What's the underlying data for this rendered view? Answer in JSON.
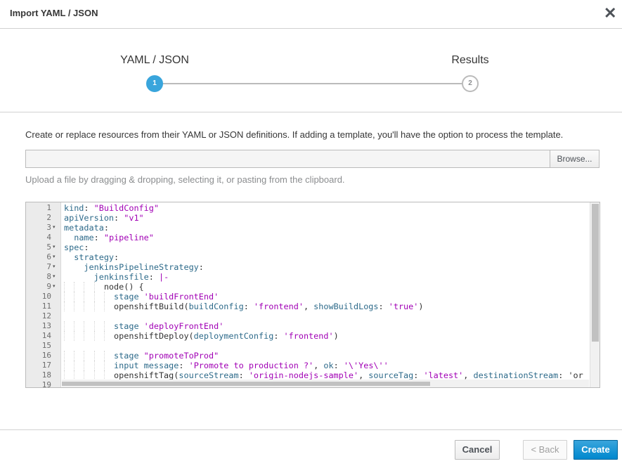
{
  "dialog": {
    "title": "Import YAML / JSON",
    "close_glyph": "✕"
  },
  "wizard": {
    "steps": [
      {
        "label": "YAML / JSON",
        "number": "1",
        "state": "active"
      },
      {
        "label": "Results",
        "number": "2",
        "state": "inactive"
      }
    ]
  },
  "form": {
    "description": "Create or replace resources from their YAML or JSON definitions. If adding a template, you'll have the option to process the template.",
    "file_value": "",
    "browse_label": "Browse...",
    "help_text": "Upload a file by dragging & dropping, selecting it, or pasting from the clipboard."
  },
  "editor": {
    "line_numbers": [
      "1",
      "2",
      "3",
      "4",
      "5",
      "6",
      "7",
      "8",
      "9",
      "10",
      "11",
      "12",
      "13",
      "14",
      "15",
      "16",
      "17",
      "18",
      "19"
    ],
    "fold_markers": {
      "3": "▾",
      "5": "▾",
      "6": "▾",
      "7": "▾",
      "8": "▾",
      "9": "▾"
    },
    "lines": [
      "kind: \"BuildConfig\"",
      "apiVersion: \"v1\"",
      "metadata:",
      "  name: \"pipeline\"",
      "spec:",
      "  strategy:",
      "    jenkinsPipelineStrategy:",
      "      jenkinsfile: |-",
      "        node() {",
      "          stage 'buildFrontEnd'",
      "          openshiftBuild(buildConfig: 'frontend', showBuildLogs: 'true')",
      "",
      "          stage 'deployFrontEnd'",
      "          openshiftDeploy(deploymentConfig: 'frontend')",
      "",
      "          stage \"promoteToProd\"",
      "          input message: 'Promote to production ?', ok: '\\'Yes\\''",
      "          openshiftTag(sourceStream: 'origin-nodejs-sample', sourceTag: 'latest', destinationStream: 'or",
      ""
    ]
  },
  "footer": {
    "cancel_label": "Cancel",
    "back_label": "< Back",
    "create_label": "Create"
  },
  "colors": {
    "primary": "#0088ce",
    "step_active": "#39a5dc",
    "yaml_key": "#2d6a8a",
    "yaml_string": "#a100b5"
  }
}
